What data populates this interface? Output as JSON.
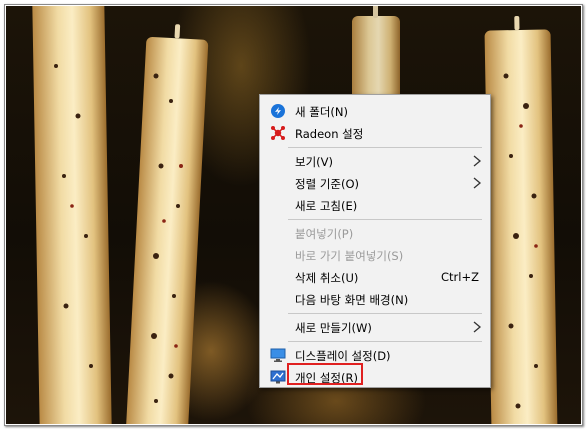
{
  "context_menu": {
    "items": [
      {
        "label": "새 폴더(N)",
        "icon": "new-folder-icon",
        "enabled": true
      },
      {
        "label": "Radeon 설정",
        "icon": "radeon-icon",
        "enabled": true
      },
      {
        "label": "보기(V)",
        "submenu": true,
        "enabled": true
      },
      {
        "label": "정렬 기준(O)",
        "submenu": true,
        "enabled": true
      },
      {
        "label": "새로 고침(E)",
        "enabled": true
      },
      {
        "label": "붙여넣기(P)",
        "enabled": false
      },
      {
        "label": "바로 가기 붙여넣기(S)",
        "enabled": false
      },
      {
        "label": "삭제 취소(U)",
        "shortcut": "Ctrl+Z",
        "enabled": true
      },
      {
        "label": "다음 바탕 화면 배경(N)",
        "enabled": true
      },
      {
        "label": "새로 만들기(W)",
        "submenu": true,
        "enabled": true
      },
      {
        "label": "디스플레이 설정(D)",
        "icon": "display-icon",
        "enabled": true
      },
      {
        "label": "개인 설정(R)",
        "icon": "personalize-icon",
        "enabled": true,
        "highlighted": true
      }
    ]
  },
  "colors": {
    "menu_background": "#f2f2f2",
    "highlight_border": "#e02020",
    "disabled_text": "#9a9a9a"
  }
}
